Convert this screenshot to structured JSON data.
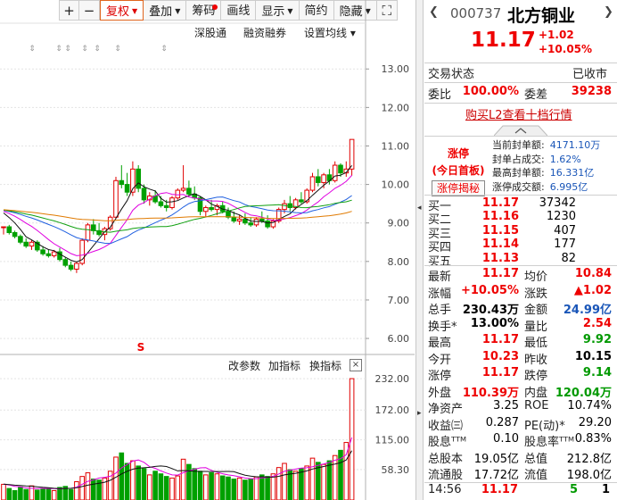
{
  "toolbar": {
    "buttons": [
      {
        "label": "+",
        "type": "sym"
      },
      {
        "label": "−",
        "type": "sym"
      },
      {
        "label": "复权",
        "active": true,
        "caret": true
      },
      {
        "label": "叠加",
        "caret": true
      },
      {
        "label": "筹码",
        "dot": true
      },
      {
        "label": "画线"
      },
      {
        "label": "显示",
        "caret": true
      },
      {
        "label": "简约"
      },
      {
        "label": "隐藏",
        "caret": true
      },
      {
        "label": "⛶",
        "type": "sym"
      }
    ]
  },
  "subbar": {
    "item1": "深股通",
    "item2": "融资融券",
    "item3": "设置均线 ▾"
  },
  "price_axis": [
    "13.00",
    "12.00",
    "11.00",
    "10.00",
    "9.00",
    "8.00",
    "7.00",
    "6.00"
  ],
  "volume_axis": [
    "232.00",
    "172.00",
    "115.00",
    "58.30"
  ],
  "volume_tools": {
    "edit": "改参数",
    "add": "加指标",
    "switch": "换指标",
    "close": "×"
  },
  "marker_s": "S",
  "chart_data": {
    "type": "candlestick",
    "ylim": [
      5.7,
      13.4
    ],
    "candles": [
      [
        8.9,
        8.9,
        8.7,
        8.9
      ],
      [
        8.9,
        8.95,
        8.7,
        8.75
      ],
      [
        8.75,
        8.8,
        8.6,
        8.65
      ],
      [
        8.65,
        8.7,
        8.45,
        8.5
      ],
      [
        8.5,
        8.6,
        8.35,
        8.4
      ],
      [
        8.4,
        8.55,
        8.3,
        8.5
      ],
      [
        8.5,
        8.55,
        8.25,
        8.3
      ],
      [
        8.3,
        8.4,
        8.15,
        8.2
      ],
      [
        8.2,
        8.3,
        8.1,
        8.15
      ],
      [
        8.15,
        8.3,
        8.1,
        8.25
      ],
      [
        8.25,
        8.35,
        8.0,
        8.05
      ],
      [
        8.05,
        8.1,
        7.85,
        7.9
      ],
      [
        7.9,
        8.0,
        7.75,
        7.8
      ],
      [
        7.8,
        8.0,
        7.7,
        7.95
      ],
      [
        7.95,
        8.6,
        7.9,
        8.55
      ],
      [
        8.55,
        9.0,
        8.5,
        8.95
      ],
      [
        8.95,
        9.1,
        8.7,
        8.8
      ],
      [
        8.8,
        9.0,
        8.65,
        8.7
      ],
      [
        8.7,
        8.9,
        8.55,
        8.85
      ],
      [
        8.85,
        9.2,
        8.8,
        9.15
      ],
      [
        9.15,
        10.2,
        9.1,
        10.1
      ],
      [
        10.1,
        10.5,
        9.9,
        10.0
      ],
      [
        10.0,
        10.3,
        9.7,
        9.8
      ],
      [
        9.8,
        10.6,
        9.7,
        10.4
      ],
      [
        10.4,
        10.5,
        9.8,
        9.9
      ],
      [
        9.9,
        10.0,
        9.5,
        9.6
      ],
      [
        9.6,
        9.8,
        9.45,
        9.7
      ],
      [
        9.7,
        9.85,
        9.5,
        9.55
      ],
      [
        9.55,
        9.7,
        9.4,
        9.45
      ],
      [
        9.45,
        9.6,
        9.3,
        9.4
      ],
      [
        9.4,
        9.7,
        9.35,
        9.65
      ],
      [
        9.65,
        9.9,
        9.6,
        9.85
      ],
      [
        9.85,
        10.5,
        9.8,
        9.9
      ],
      [
        9.9,
        10.1,
        9.7,
        9.75
      ],
      [
        9.75,
        9.95,
        9.6,
        9.65
      ],
      [
        9.65,
        9.7,
        9.2,
        9.3
      ],
      [
        9.3,
        9.45,
        9.15,
        9.4
      ],
      [
        9.4,
        9.6,
        9.3,
        9.35
      ],
      [
        9.35,
        9.5,
        9.2,
        9.45
      ],
      [
        9.45,
        9.55,
        9.25,
        9.3
      ],
      [
        9.3,
        9.4,
        9.1,
        9.15
      ],
      [
        9.15,
        9.3,
        9.0,
        9.05
      ],
      [
        9.05,
        9.2,
        8.95,
        9.1
      ],
      [
        9.1,
        9.25,
        8.95,
        9.0
      ],
      [
        9.0,
        9.15,
        8.9,
        8.95
      ],
      [
        8.95,
        9.15,
        8.9,
        9.1
      ],
      [
        9.1,
        9.3,
        9.0,
        9.05
      ],
      [
        9.05,
        9.2,
        8.85,
        8.9
      ],
      [
        8.9,
        9.1,
        8.85,
        9.05
      ],
      [
        9.05,
        9.4,
        9.0,
        9.35
      ],
      [
        9.35,
        9.6,
        9.25,
        9.5
      ],
      [
        9.5,
        9.7,
        9.3,
        9.4
      ],
      [
        9.4,
        9.65,
        9.35,
        9.6
      ],
      [
        9.6,
        9.8,
        9.5,
        9.55
      ],
      [
        9.55,
        9.9,
        9.5,
        9.85
      ],
      [
        9.85,
        10.3,
        9.8,
        10.2
      ],
      [
        10.2,
        10.4,
        9.95,
        10.05
      ],
      [
        10.05,
        10.3,
        9.9,
        10.25
      ],
      [
        10.25,
        10.4,
        10.0,
        10.1
      ],
      [
        10.1,
        10.6,
        10.05,
        10.5
      ],
      [
        10.5,
        10.55,
        10.2,
        10.3
      ],
      [
        10.3,
        10.6,
        10.2,
        10.4
      ],
      [
        10.4,
        11.17,
        10.23,
        11.17
      ]
    ],
    "volumes": [
      30,
      22,
      18,
      25,
      20,
      27,
      19,
      21,
      23,
      18,
      24,
      26,
      20,
      35,
      45,
      52,
      40,
      38,
      42,
      55,
      82,
      90,
      70,
      75,
      65,
      60,
      48,
      55,
      50,
      45,
      42,
      46,
      78,
      68,
      60,
      55,
      48,
      52,
      50,
      46,
      44,
      40,
      42,
      38,
      40,
      44,
      48,
      45,
      50,
      62,
      70,
      58,
      55,
      60,
      65,
      80,
      72,
      68,
      75,
      85,
      95,
      110,
      232
    ],
    "ma_lines": [
      {
        "name": "MA5",
        "color": "#111111"
      },
      {
        "name": "MA10",
        "color": "#e000e0"
      },
      {
        "name": "MA20",
        "color": "#2060e0"
      },
      {
        "name": "MA30",
        "color": "#10a010"
      },
      {
        "name": "MA60",
        "color": "#e07a00"
      }
    ]
  },
  "quote": {
    "code": "000737",
    "name": "北方铜业",
    "price": "11.17",
    "change": "+1.02",
    "change_pct": "+10.05%",
    "trade_status_label": "交易状态",
    "trade_status": "已收市",
    "weibi_label": "委比",
    "weibi": "100.00%",
    "weicha_label": "委差",
    "weicha": "39238",
    "l2_link": "购买L2查看十档行情",
    "zhangting": "涨停",
    "first_board": "(今日首板)",
    "reveal_btn": "涨停揭秘",
    "seal": [
      {
        "k": "当前封单额:",
        "v": "4171.10万"
      },
      {
        "k": "封单占成交:",
        "v": "1.62%"
      },
      {
        "k": "最高封单额:",
        "v": "16.331亿"
      },
      {
        "k": "涨停成交额:",
        "v": "6.995亿"
      }
    ],
    "orderbook": [
      {
        "label": "买一",
        "price": "11.17",
        "vol": "37342"
      },
      {
        "label": "买二",
        "price": "11.16",
        "vol": "1230"
      },
      {
        "label": "买三",
        "price": "11.15",
        "vol": "407"
      },
      {
        "label": "买四",
        "price": "11.14",
        "vol": "177"
      },
      {
        "label": "买五",
        "price": "11.13",
        "vol": "82"
      }
    ],
    "stats": [
      {
        "l1": "最新",
        "v1": "11.17",
        "c1": "red",
        "l2": "均价",
        "v2": "10.84",
        "c2": "red"
      },
      {
        "l1": "涨幅",
        "v1": "+10.05%",
        "c1": "red",
        "l2": "涨跌",
        "v2": "▲1.02",
        "c2": "red"
      },
      {
        "l1": "总手",
        "v1": "230.43万",
        "c1": "black",
        "l2": "金额",
        "v2": "24.99亿",
        "c2": "blue"
      },
      {
        "l1": "换手*",
        "v1": "13.00%",
        "c1": "black",
        "l2": "量比",
        "v2": "2.54",
        "c2": "red"
      },
      {
        "l1": "最高",
        "v1": "11.17",
        "c1": "red",
        "l2": "最低",
        "v2": "9.92",
        "c2": "green"
      },
      {
        "l1": "今开",
        "v1": "10.23",
        "c1": "red",
        "l2": "昨收",
        "v2": "10.15",
        "c2": "black"
      },
      {
        "l1": "涨停",
        "v1": "11.17",
        "c1": "red",
        "l2": "跌停",
        "v2": "9.14",
        "c2": "green"
      },
      {
        "l1": "外盘",
        "v1": "110.39万",
        "c1": "red",
        "l2": "内盘",
        "v2": "120.04万",
        "c2": "green"
      },
      {
        "l1": "净资产",
        "v1": "3.25",
        "c1": "blk-n",
        "l2": "ROE",
        "v2": "10.74%",
        "c2": "blk-n"
      },
      {
        "l1": "收益㈢",
        "v1": "0.287",
        "c1": "blk-n",
        "l2": "PE(动)*",
        "v2": "29.20",
        "c2": "blk-n"
      },
      {
        "l1": "股息ᵀᵀᴹ",
        "v1": "0.10",
        "c1": "blk-n",
        "l2": "股息率ᵀᵀᴹ",
        "v2": "0.83%",
        "c2": "blk-n"
      },
      {
        "l1": "总股本",
        "v1": "19.05亿",
        "c1": "blk-n",
        "l2": "总值",
        "v2": "212.8亿",
        "c2": "blk-n"
      },
      {
        "l1": "流通股",
        "v1": "17.72亿",
        "c1": "blk-n",
        "l2": "流值",
        "v2": "198.0亿",
        "c2": "blk-n"
      }
    ],
    "last_trade": {
      "time": "14:56",
      "price": "11.17",
      "vol": "5",
      "count": "1"
    }
  },
  "colors": {
    "up": "#e00000",
    "down": "#00a000",
    "accent": "#e0651e"
  }
}
